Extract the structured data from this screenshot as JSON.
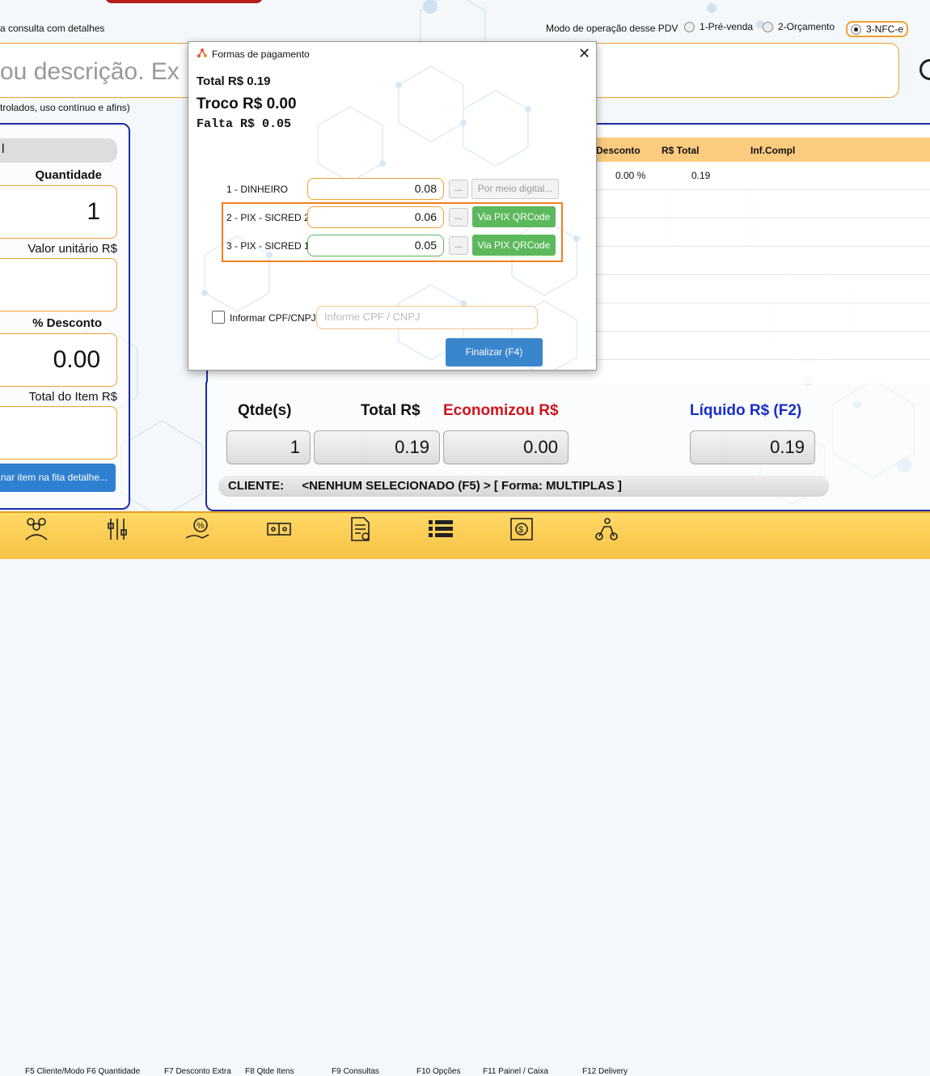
{
  "top": {
    "consulta_text": "a consulta com detalhes",
    "mode_label": "Modo de operação desse PDV",
    "modes": [
      {
        "label": "1-Pré-venda",
        "selected": false
      },
      {
        "label": "2-Orçamento",
        "selected": false
      },
      {
        "label": "3-NFC-e",
        "selected": true
      }
    ],
    "search_placeholder": "ou descrição. Ex",
    "search_hint": "trolados, uso contínuo e afins)"
  },
  "left_panel": {
    "tab_text": "l",
    "quantidade_label": "Quantidade",
    "quantidade_value": "1",
    "valor_unitario_label": "Valor unitário R$",
    "valor_unitario_value": "",
    "desconto_label": "% Desconto",
    "desconto_value": "0.00",
    "total_item_label": "Total do Item R$",
    "total_item_value": "",
    "button_label": "nar item na fita detalhe..."
  },
  "table": {
    "columns": [
      "Desconto",
      "R$ Total",
      "Inf.Compl"
    ],
    "rows": [
      {
        "desconto": "0.00 %",
        "total": "0.19",
        "inf": ""
      }
    ]
  },
  "summary": {
    "qtde_label": "Qtde(s)",
    "qtde_value": "1",
    "total_label": "Total R$",
    "total_value": "0.19",
    "economizou_label": "Economizou R$",
    "economizou_value": "0.00",
    "liquido_label": "Líquido R$ (F2)",
    "liquido_value": "0.19",
    "cliente_label": "CLIENTE:",
    "cliente_value": "<NENHUM SELECIONADO (F5) > [ Forma: MULTIPLAS ]"
  },
  "bottom_bar": {
    "items": [
      {
        "icon": "clients-icon",
        "label": "F5 Cliente/Modo"
      },
      {
        "icon": "tools-icon",
        "label": "F6 Quantidade"
      },
      {
        "icon": "discount-hand-icon",
        "label": "F7 Desconto Extra"
      },
      {
        "icon": "ticket-icon",
        "label": "F8 Qtde Itens"
      },
      {
        "icon": "document-icon",
        "label": "F9 Consultas"
      },
      {
        "icon": "list-icon",
        "label": "F10 Opções"
      },
      {
        "icon": "money-icon",
        "label": "F11 Painel / Caixa"
      },
      {
        "icon": "delivery-icon",
        "label": "F12 Delivery"
      }
    ]
  },
  "dialog": {
    "title": "Formas de pagamento",
    "total": "Total R$ 0.19",
    "troco": "Troco R$ 0.00",
    "falta": "Falta R$ 0.05",
    "payments": [
      {
        "label": "1 - DINHEIRO",
        "value": "0.08",
        "button": "Por meio digital..."
      },
      {
        "label": "2 - PIX - SICRED 2",
        "value": "0.06",
        "button": "Via PIX QRCode"
      },
      {
        "label": "3 - PIX - SICRED 1",
        "value": "0.05",
        "button": "Via PIX QRCode"
      }
    ],
    "dots_label": "...",
    "cpf_label": "Informar CPF/CNPJ",
    "cpf_placeholder": "Informe CPF / CNPJ",
    "finalizar_label": "Finalizar (F4)"
  },
  "colors": {
    "accent_orange": "#f0a030",
    "highlight_orange": "#f07f1e",
    "pix_green": "#5cb85c",
    "finalizar_blue": "#3a86cc",
    "economizou_red": "#d0141a",
    "liquido_blue": "#1a2ec8"
  }
}
